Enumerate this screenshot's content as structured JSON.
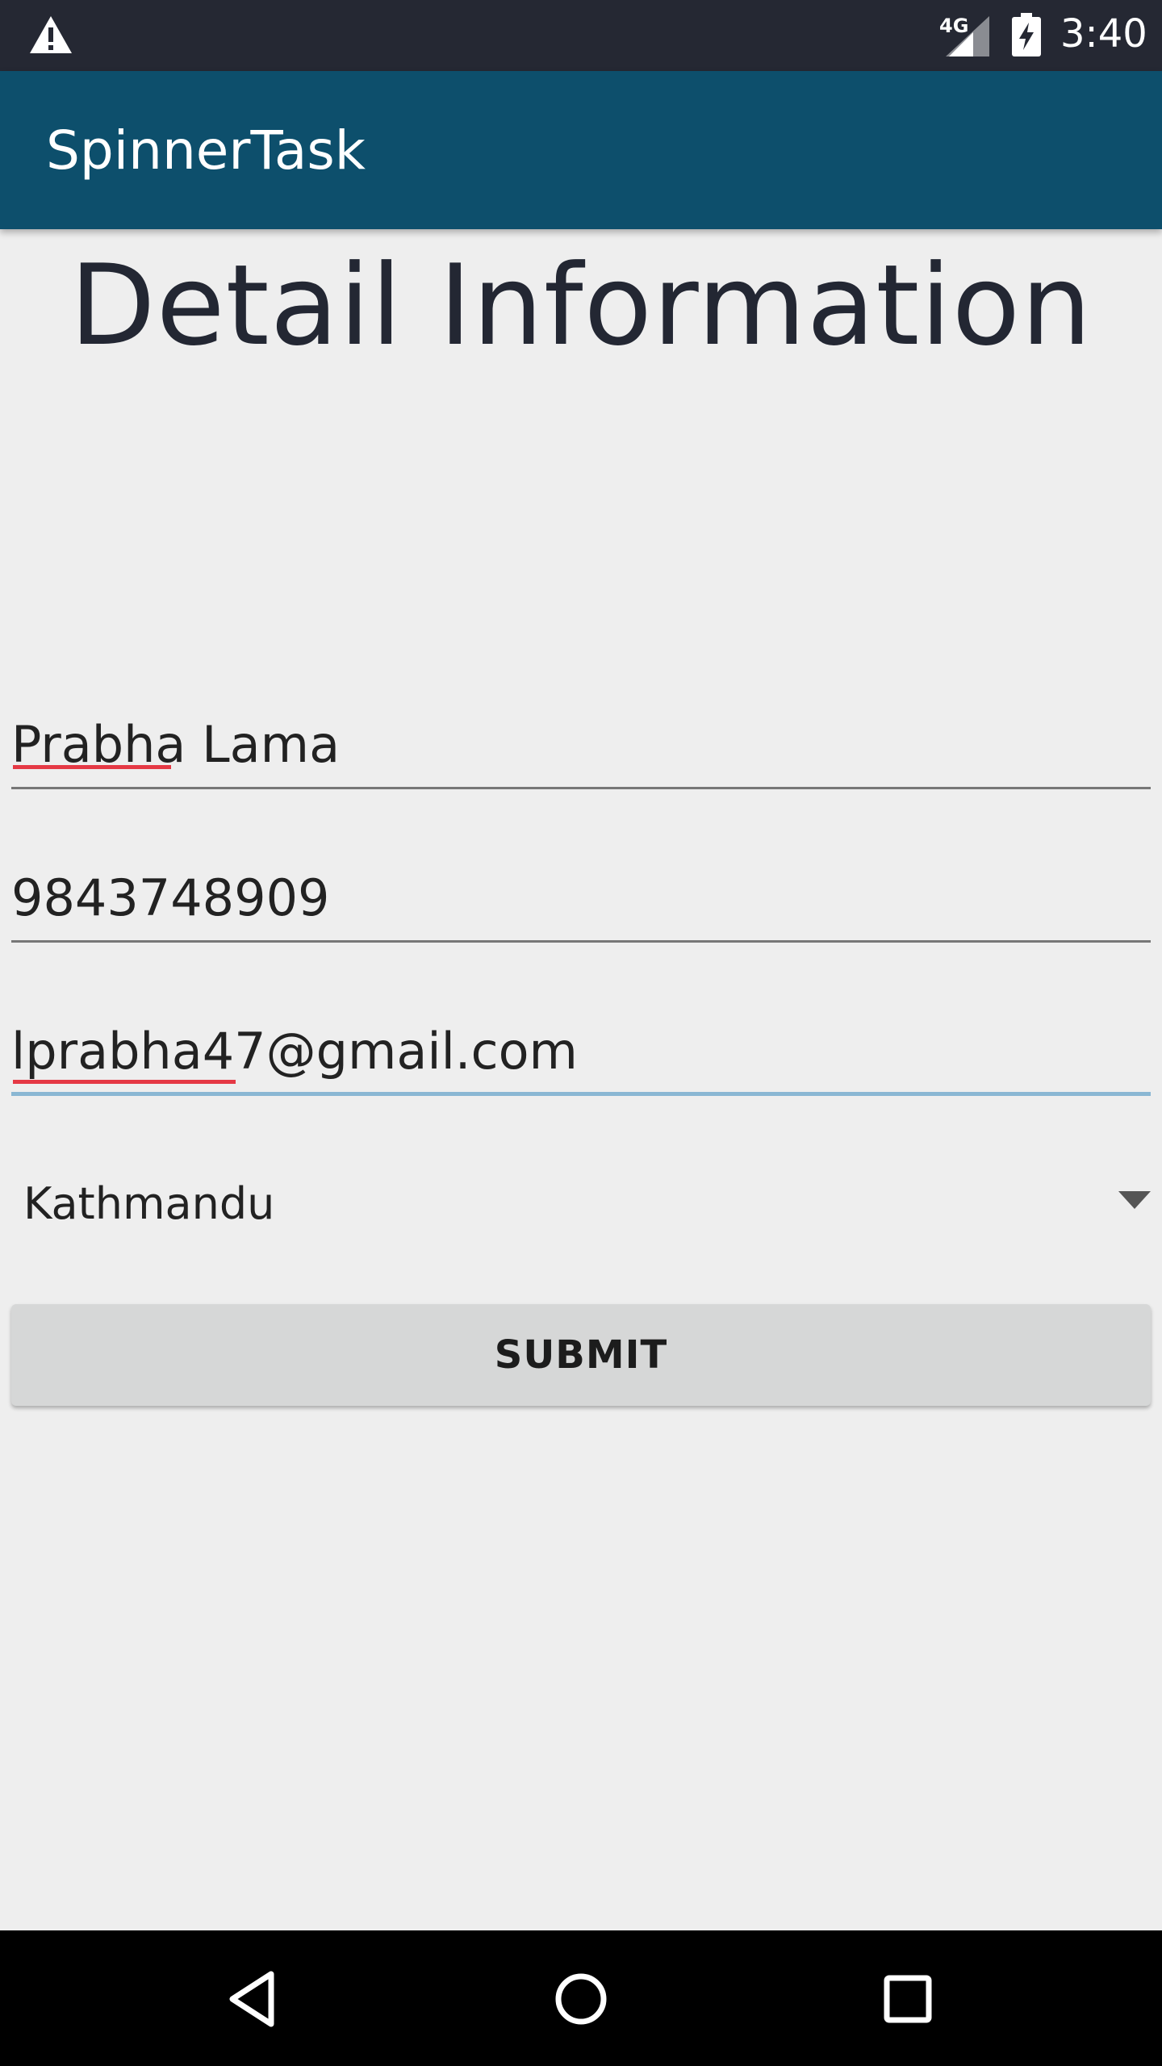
{
  "status_bar": {
    "network": "4G",
    "time": "3:40",
    "icons": [
      "warning-icon",
      "signal-icon",
      "battery-charging-icon"
    ]
  },
  "app_bar": {
    "title": "SpinnerTask"
  },
  "page": {
    "heading": "Detail Information",
    "fields": {
      "name": "Prabha Lama",
      "phone": "9843748909",
      "email": "lprabha47@gmail.com"
    },
    "spinner": {
      "selected": "Kathmandu"
    },
    "submit_label": "SUBMIT"
  },
  "nav_bar": {
    "icons": [
      "back-icon",
      "home-icon",
      "recents-icon"
    ]
  },
  "colors": {
    "status_bar": "#252833",
    "app_bar": "#0d4f6c",
    "background": "#eeeeee",
    "focus_underline": "#8ab7d3",
    "spellcheck_underline": "#e53945"
  }
}
